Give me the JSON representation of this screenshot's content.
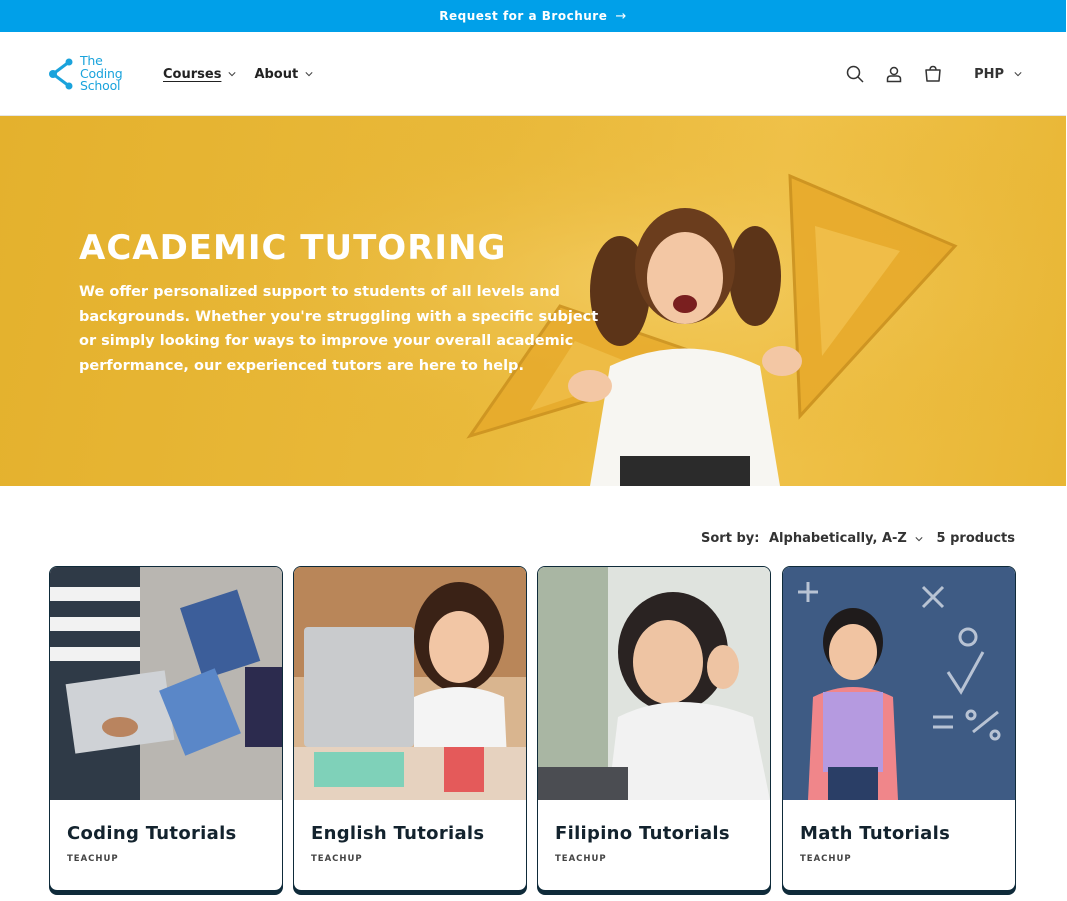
{
  "announcement": {
    "text": "Request for a Brochure",
    "arrow": "→"
  },
  "header": {
    "logo_lines": [
      "The",
      "Coding",
      "School"
    ],
    "nav": [
      {
        "label": "Courses",
        "active": true
      },
      {
        "label": "About",
        "active": false
      }
    ],
    "icons": [
      "search-icon",
      "account-icon",
      "cart-icon"
    ],
    "currency": "PHP"
  },
  "hero": {
    "title": "ACADEMIC TUTORING",
    "description": "We offer personalized support to students of all levels and backgrounds. Whether you're struggling with a specific subject or simply looking for ways to improve your overall academic performance, our experienced tutors are here to help."
  },
  "toolbar": {
    "sort_label": "Sort by:",
    "sort_value": "Alphabetically, A-Z",
    "count": "5 products"
  },
  "products": [
    {
      "title": "Coding Tutorials",
      "vendor": "TEACHUP"
    },
    {
      "title": "English Tutorials",
      "vendor": "TEACHUP"
    },
    {
      "title": "Filipino Tutorials",
      "vendor": "TEACHUP"
    },
    {
      "title": "Math Tutorials",
      "vendor": "TEACHUP"
    }
  ],
  "colors": {
    "announcement_bg": "#00a0e9",
    "brand": "#1aa3dc",
    "hero_bg": "#e9b93a",
    "card_border": "#0f2b3a"
  }
}
